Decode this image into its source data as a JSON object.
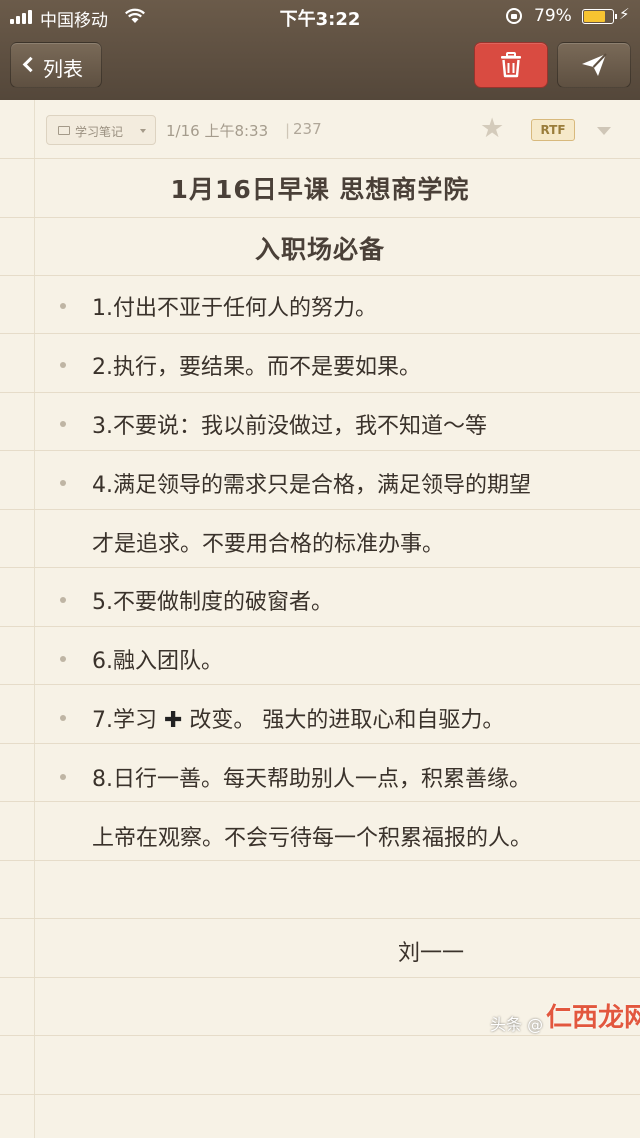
{
  "status_bar": {
    "carrier": "中国移动",
    "time": "下午3:22",
    "battery_percent": "79%",
    "battery_level": 0.79,
    "battery_color": "#f7c431"
  },
  "nav": {
    "back_label": "列表",
    "back_icon": "chevron-left-icon",
    "delete_icon": "trash-icon",
    "send_icon": "send-icon",
    "delete_color": "#d94b41"
  },
  "note_meta": {
    "notebook": "学习笔记",
    "date": "1/16 上午8:33",
    "word_count": "237",
    "format_badge": "RTF",
    "star_icon": "star-icon"
  },
  "note": {
    "title": "1月16日早课  思想商学院",
    "subtitle": "入职场必备",
    "items": [
      {
        "line1": "1.付出不亚于任何人的努力。"
      },
      {
        "line1": "2.执行，要结果。而不是要如果。"
      },
      {
        "line1": "3.不要说：我以前没做过，我不知道～等"
      },
      {
        "line1": "4.满足领导的需求只是合格，满足领导的期望",
        "line2": "才是追求。不要用合格的标准办事。"
      },
      {
        "line1": "5.不要做制度的破窗者。"
      },
      {
        "line1": "6.融入团队。"
      },
      {
        "line1a": "7.学习 ",
        "line1b": " 改变。 强大的进取心和自驱力。"
      },
      {
        "line1": "8.日行一善。每天帮助别人一点，积累善缘。",
        "line2": "上帝在观察。不会亏待每一个积累福报的人。"
      }
    ],
    "signature": "刘一一"
  },
  "watermark": {
    "text": "头条 @",
    "logo_text": "仁西龙网"
  }
}
